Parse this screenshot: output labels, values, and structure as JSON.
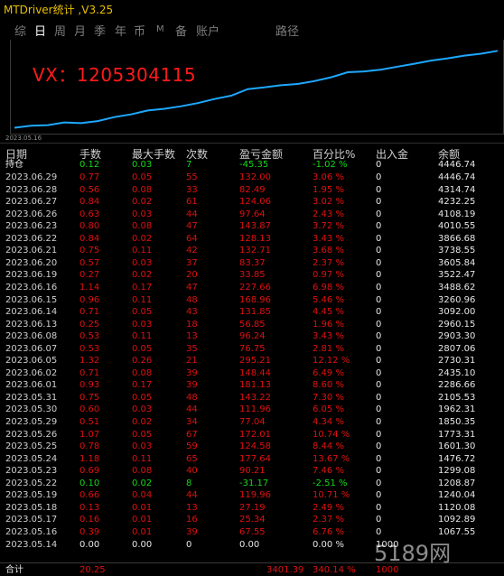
{
  "window": {
    "title": "MTDriver统计 ,V3.25"
  },
  "tabs": [
    {
      "label": "综",
      "active": false
    },
    {
      "label": "日",
      "active": true
    },
    {
      "label": "周",
      "active": false
    },
    {
      "label": "月",
      "active": false
    },
    {
      "label": "季",
      "active": false
    },
    {
      "label": "年",
      "active": false
    },
    {
      "label": "币",
      "active": false
    },
    {
      "label": "M",
      "active": false
    },
    {
      "label": "备",
      "active": false
    },
    {
      "label": "账户",
      "active": false
    },
    {
      "label": "路径",
      "active": false
    }
  ],
  "chart": {
    "overlay_text": "VX：1205304115",
    "start_date": "2023.05.16"
  },
  "chart_data": {
    "type": "line",
    "series": [
      {
        "values": [
          1001.5,
          1092.89,
          1120.08,
          1240.04,
          1208.87,
          1299.08,
          1476.72,
          1601.3,
          1773.31,
          1850.35,
          1962.31,
          2105.53,
          2286.66,
          2435.1,
          2730.31,
          2807.06,
          2903.3,
          2960.15,
          3092.0,
          3260.96,
          3488.62,
          3522.47,
          3605.84,
          3738.55,
          3866.68,
          4010.55,
          4108.19,
          4232.25,
          4314.74,
          4446.74
        ]
      }
    ]
  },
  "table": {
    "headers": [
      "日期",
      "手数",
      "最大手数",
      "次数",
      "盈亏金额",
      "百分比%",
      "出入金",
      "余额"
    ],
    "open_row": {
      "date": "持仓",
      "lots": "0.12",
      "max_lots": "0.03",
      "count": "7",
      "pl": "-45.35",
      "pct": "-1.02 %",
      "inout": "0",
      "balance": "4446.74"
    },
    "rows": [
      {
        "date": "2023.06.29",
        "lots": "0.77",
        "max_lots": "0.05",
        "count": "55",
        "pl": "132.00",
        "pct": "3.06 %",
        "inout": "0",
        "balance": "4446.74",
        "neg": false
      },
      {
        "date": "2023.06.28",
        "lots": "0.56",
        "max_lots": "0.08",
        "count": "33",
        "pl": "82.49",
        "pct": "1.95 %",
        "inout": "0",
        "balance": "4314.74",
        "neg": false
      },
      {
        "date": "2023.06.27",
        "lots": "0.84",
        "max_lots": "0.02",
        "count": "61",
        "pl": "124.06",
        "pct": "3.02 %",
        "inout": "0",
        "balance": "4232.25",
        "neg": false
      },
      {
        "date": "2023.06.26",
        "lots": "0.63",
        "max_lots": "0.03",
        "count": "44",
        "pl": "97.64",
        "pct": "2.43 %",
        "inout": "0",
        "balance": "4108.19",
        "neg": false
      },
      {
        "date": "2023.06.23",
        "lots": "0.80",
        "max_lots": "0.08",
        "count": "47",
        "pl": "143.87",
        "pct": "3.72 %",
        "inout": "0",
        "balance": "4010.55",
        "neg": false
      },
      {
        "date": "2023.06.22",
        "lots": "0.84",
        "max_lots": "0.02",
        "count": "64",
        "pl": "128.13",
        "pct": "3.43 %",
        "inout": "0",
        "balance": "3866.68",
        "neg": false
      },
      {
        "date": "2023.06.21",
        "lots": "0.75",
        "max_lots": "0.11",
        "count": "42",
        "pl": "132.71",
        "pct": "3.68 %",
        "inout": "0",
        "balance": "3738.55",
        "neg": false
      },
      {
        "date": "2023.06.20",
        "lots": "0.57",
        "max_lots": "0.03",
        "count": "37",
        "pl": "83.37",
        "pct": "2.37 %",
        "inout": "0",
        "balance": "3605.84",
        "neg": false
      },
      {
        "date": "2023.06.19",
        "lots": "0.27",
        "max_lots": "0.02",
        "count": "20",
        "pl": "33.85",
        "pct": "0.97 %",
        "inout": "0",
        "balance": "3522.47",
        "neg": false
      },
      {
        "date": "2023.06.16",
        "lots": "1.14",
        "max_lots": "0.17",
        "count": "47",
        "pl": "227.66",
        "pct": "6.98 %",
        "inout": "0",
        "balance": "3488.62",
        "neg": false
      },
      {
        "date": "2023.06.15",
        "lots": "0.96",
        "max_lots": "0.11",
        "count": "48",
        "pl": "168.96",
        "pct": "5.46 %",
        "inout": "0",
        "balance": "3260.96",
        "neg": false
      },
      {
        "date": "2023.06.14",
        "lots": "0.71",
        "max_lots": "0.05",
        "count": "43",
        "pl": "131.85",
        "pct": "4.45 %",
        "inout": "0",
        "balance": "3092.00",
        "neg": false
      },
      {
        "date": "2023.06.13",
        "lots": "0.25",
        "max_lots": "0.03",
        "count": "18",
        "pl": "56.85",
        "pct": "1.96 %",
        "inout": "0",
        "balance": "2960.15",
        "neg": false
      },
      {
        "date": "2023.06.08",
        "lots": "0.53",
        "max_lots": "0.11",
        "count": "13",
        "pl": "96.24",
        "pct": "3.43 %",
        "inout": "0",
        "balance": "2903.30",
        "neg": false
      },
      {
        "date": "2023.06.07",
        "lots": "0.53",
        "max_lots": "0.05",
        "count": "35",
        "pl": "76.75",
        "pct": "2.81 %",
        "inout": "0",
        "balance": "2807.06",
        "neg": false
      },
      {
        "date": "2023.06.05",
        "lots": "1.32",
        "max_lots": "0.26",
        "count": "21",
        "pl": "295.21",
        "pct": "12.12 %",
        "inout": "0",
        "balance": "2730.31",
        "neg": false
      },
      {
        "date": "2023.06.02",
        "lots": "0.71",
        "max_lots": "0.08",
        "count": "39",
        "pl": "148.44",
        "pct": "6.49 %",
        "inout": "0",
        "balance": "2435.10",
        "neg": false
      },
      {
        "date": "2023.06.01",
        "lots": "0.93",
        "max_lots": "0.17",
        "count": "39",
        "pl": "181.13",
        "pct": "8.60 %",
        "inout": "0",
        "balance": "2286.66",
        "neg": false
      },
      {
        "date": "2023.05.31",
        "lots": "0.75",
        "max_lots": "0.05",
        "count": "48",
        "pl": "143.22",
        "pct": "7.30 %",
        "inout": "0",
        "balance": "2105.53",
        "neg": false
      },
      {
        "date": "2023.05.30",
        "lots": "0.60",
        "max_lots": "0.03",
        "count": "44",
        "pl": "111.96",
        "pct": "6.05 %",
        "inout": "0",
        "balance": "1962.31",
        "neg": false
      },
      {
        "date": "2023.05.29",
        "lots": "0.51",
        "max_lots": "0.02",
        "count": "34",
        "pl": "77.04",
        "pct": "4.34 %",
        "inout": "0",
        "balance": "1850.35",
        "neg": false
      },
      {
        "date": "2023.05.26",
        "lots": "1.07",
        "max_lots": "0.05",
        "count": "67",
        "pl": "172.01",
        "pct": "10.74 %",
        "inout": "0",
        "balance": "1773.31",
        "neg": false
      },
      {
        "date": "2023.05.25",
        "lots": "0.78",
        "max_lots": "0.03",
        "count": "59",
        "pl": "124.58",
        "pct": "8.44 %",
        "inout": "0",
        "balance": "1601.30",
        "neg": false
      },
      {
        "date": "2023.05.24",
        "lots": "1.18",
        "max_lots": "0.11",
        "count": "65",
        "pl": "177.64",
        "pct": "13.67 %",
        "inout": "0",
        "balance": "1476.72",
        "neg": false
      },
      {
        "date": "2023.05.23",
        "lots": "0.69",
        "max_lots": "0.08",
        "count": "40",
        "pl": "90.21",
        "pct": "7.46 %",
        "inout": "0",
        "balance": "1299.08",
        "neg": false
      },
      {
        "date": "2023.05.22",
        "lots": "0.10",
        "max_lots": "0.02",
        "count": "8",
        "pl": "-31.17",
        "pct": "-2.51 %",
        "inout": "0",
        "balance": "1208.87",
        "neg": true
      },
      {
        "date": "2023.05.19",
        "lots": "0.66",
        "max_lots": "0.04",
        "count": "44",
        "pl": "119.96",
        "pct": "10.71 %",
        "inout": "0",
        "balance": "1240.04",
        "neg": false
      },
      {
        "date": "2023.05.18",
        "lots": "0.13",
        "max_lots": "0.01",
        "count": "13",
        "pl": "27.19",
        "pct": "2.49 %",
        "inout": "0",
        "balance": "1120.08",
        "neg": false
      },
      {
        "date": "2023.05.17",
        "lots": "0.16",
        "max_lots": "0.01",
        "count": "16",
        "pl": "25.34",
        "pct": "2.37 %",
        "inout": "0",
        "balance": "1092.89",
        "neg": false
      },
      {
        "date": "2023.05.16",
        "lots": "0.39",
        "max_lots": "0.01",
        "count": "39",
        "pl": "67.55",
        "pct": "6.76 %",
        "inout": "0",
        "balance": "1067.55",
        "neg": false
      },
      {
        "date": "2023.05.14",
        "lots": "0.00",
        "max_lots": "0.00",
        "count": "0",
        "pl": "0.00",
        "pct": "0.00 %",
        "inout": "1000",
        "balance": "",
        "neg": null
      }
    ],
    "total": {
      "date": "合计",
      "lots": "20.25",
      "pl": "3401.39",
      "pct": "340.14 %",
      "inout": "1000"
    }
  },
  "watermark": "5189网",
  "colors": {
    "positive": "#e01010",
    "negative": "#19d619",
    "curve": "#1ea8ff",
    "title": "#e8c000"
  }
}
